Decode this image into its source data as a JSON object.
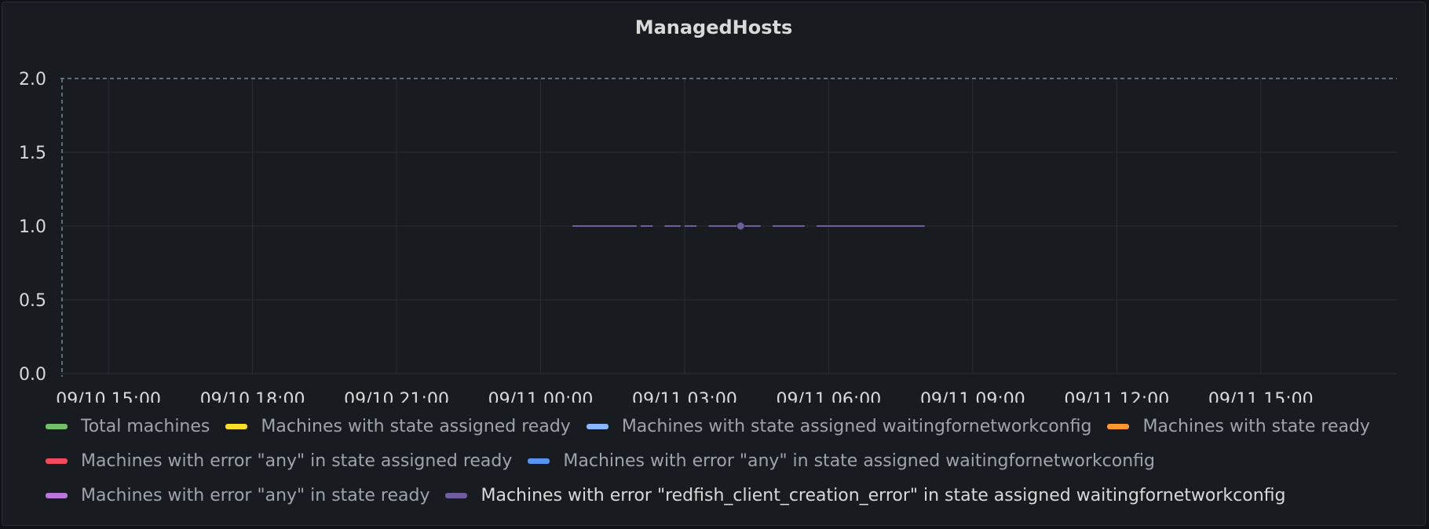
{
  "panel": {
    "title": "ManagedHosts"
  },
  "chart_data": {
    "type": "line",
    "title": "ManagedHosts",
    "xlabel": "",
    "ylabel": "",
    "x_range": [
      "09/10 14:00",
      "09/11 17:50"
    ],
    "ylim": [
      0,
      2
    ],
    "y_ticks": [
      "0.0",
      "0.5",
      "1.0",
      "1.5",
      "2.0"
    ],
    "x_ticks": [
      "09/10 15:00",
      "09/10 18:00",
      "09/10 21:00",
      "09/11 00:00",
      "09/11 03:00",
      "09/11 06:00",
      "09/11 09:00",
      "09/11 12:00",
      "09/11 15:00"
    ],
    "grid": true,
    "threshold": 2.0,
    "legend_position": "bottom",
    "series": [
      {
        "name": "Total machines",
        "color": "#73bf69",
        "values": []
      },
      {
        "name": "Machines with state assigned ready",
        "color": "#fade2a",
        "values": []
      },
      {
        "name": "Machines with state assigned waitingfornetworkconfig",
        "color": "#8ab8ff",
        "values": []
      },
      {
        "name": "Machines with state ready",
        "color": "#ff9830",
        "values": []
      },
      {
        "name": "Machines with error \"any\" in state assigned ready",
        "color": "#f2495c",
        "values": []
      },
      {
        "name": "Machines with error \"any\" in state assigned waitingfornetworkconfig",
        "color": "#5794f2",
        "values": []
      },
      {
        "name": "Machines with error \"any\" in state ready",
        "color": "#b877d9",
        "values": []
      },
      {
        "name": "Machines with error \"redfish_client_creation_error\" in state assigned waitingfornetworkconfig",
        "color": "#705da0",
        "segments": [
          {
            "from": "09/11 00:40",
            "to": "09/11 02:00",
            "value": 1
          },
          {
            "from": "09/11 02:05",
            "to": "09/11 02:20",
            "value": 1
          },
          {
            "from": "09/11 02:35",
            "to": "09/11 02:55",
            "value": 1
          },
          {
            "from": "09/11 03:00",
            "to": "09/11 03:15",
            "value": 1
          },
          {
            "from": "09/11 03:30",
            "to": "09/11 04:05",
            "value": 1
          },
          {
            "from": "09/11 04:15",
            "to": "09/11 04:35",
            "value": 1
          },
          {
            "from": "09/11 04:50",
            "to": "09/11 05:30",
            "value": 1
          },
          {
            "from": "09/11 05:45",
            "to": "09/11 08:00",
            "value": 1
          }
        ],
        "points": [
          {
            "x": "09/11 04:10",
            "y": 1
          }
        ]
      }
    ]
  }
}
